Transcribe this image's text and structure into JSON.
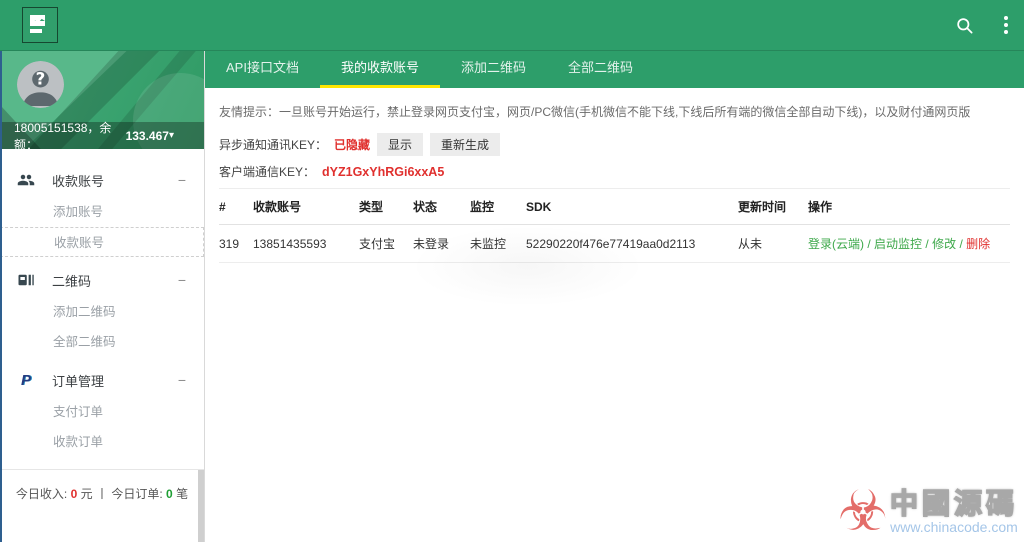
{
  "header": {
    "logo_icon": "broken-image-logo",
    "search_icon": "search",
    "more_icon": "more-vertical"
  },
  "sidebar": {
    "user": {
      "prefix": "18005151538，余额：",
      "balance": "133.467",
      "caret": "▾",
      "avatar_icon": "anonymous-user-question"
    },
    "groups": [
      {
        "icon": "users-icon",
        "label": "收款账号",
        "collapse": "−",
        "items": [
          "添加账号",
          "收款账号"
        ],
        "selected_item": "收款账号"
      },
      {
        "icon": "idcard-bars-icon",
        "label": "二维码",
        "collapse": "−",
        "items": [
          "添加二维码",
          "全部二维码"
        ]
      },
      {
        "icon": "paypal-icon",
        "icon_glyph": "P",
        "label": "订单管理",
        "collapse": "−",
        "items": [
          "支付订单",
          "收款订单"
        ]
      }
    ],
    "footer": {
      "income_label": "今日收入:",
      "income_value": "0",
      "income_unit": "元",
      "separator": "丨",
      "orders_label": "今日订单:",
      "orders_value": "0",
      "orders_unit": "笔"
    }
  },
  "tabs": [
    {
      "label": "API接口文档",
      "active": false
    },
    {
      "label": "我的收款账号",
      "active": true
    },
    {
      "label": "添加二维码",
      "active": false
    },
    {
      "label": "全部二维码",
      "active": false
    }
  ],
  "main": {
    "notice": "友情提示：一旦账号开始运行，禁止登录网页支付宝，网页/PC微信(手机微信不能下线,下线后所有端的微信全部自动下线)，以及财付通网页版",
    "async_key": {
      "label": "异步通知通讯KEY：",
      "status": "已隐藏",
      "show_button": "显示",
      "regen_button": "重新生成"
    },
    "client_key": {
      "label": "客户端通信KEY：",
      "value": "dYZ1GxYhRGi6xxA5"
    },
    "table": {
      "headers": [
        "#",
        "收款账号",
        "类型",
        "状态",
        "监控",
        "SDK",
        "更新时间",
        "操作"
      ],
      "rows": [
        {
          "id": "319",
          "account": "13851435593",
          "type": "支付宝",
          "status": "未登录",
          "monitor": "未监控",
          "sdk": "52290220f476e77419aa0d2113",
          "updated": "从未",
          "actions": [
            "登录(云端)",
            "启动监控",
            "修改",
            "删除"
          ],
          "separator": "/"
        }
      ]
    }
  },
  "watermark": {
    "logo_icon": "biohazard-logo",
    "logo_glyph": "☣",
    "title": "中國源碼",
    "url": "www.chinacode.com"
  },
  "colors": {
    "primary_green": "#2d9e6a",
    "tab_underline_yellow": "#ffe600",
    "danger_red": "#e0302e",
    "link_green": "#3da84a",
    "monitor_red": "#e0302e",
    "left_edge_blue": "#2e5f8f"
  }
}
